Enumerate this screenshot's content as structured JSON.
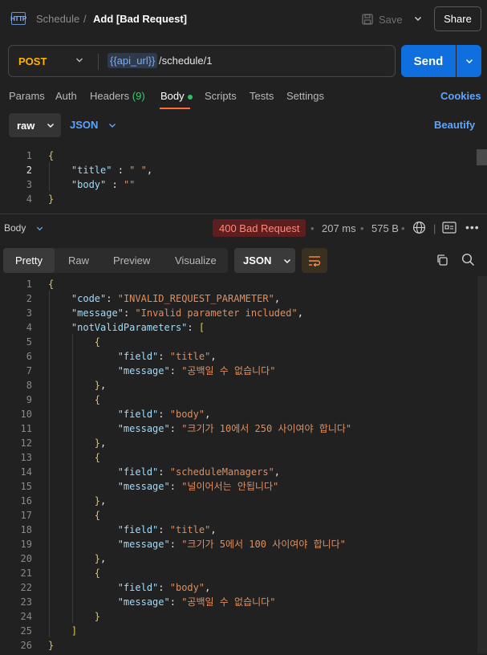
{
  "breadcrumb": {
    "icon_text": "HTTP",
    "parent": "Schedule",
    "separator": "/",
    "current": "Add [Bad Request]"
  },
  "header_actions": {
    "save_label": "Save",
    "share_label": "Share"
  },
  "request": {
    "method": "POST",
    "url_variable": "{{api_url}}",
    "url_path": "/schedule/1",
    "send_label": "Send"
  },
  "request_tabs": [
    {
      "label": "Params"
    },
    {
      "label": "Auth"
    },
    {
      "label": "Headers",
      "count": "(9)"
    },
    {
      "label": "Body"
    },
    {
      "label": "Scripts"
    },
    {
      "label": "Tests"
    },
    {
      "label": "Settings"
    }
  ],
  "cookies_label": "Cookies",
  "body_options": {
    "mode": "raw",
    "language": "JSON",
    "beautify_label": "Beautify"
  },
  "request_body_lines": [
    {
      "n": "1",
      "text": "{"
    },
    {
      "n": "2",
      "text": "    \"title\" : \" \","
    },
    {
      "n": "3",
      "text": "    \"body\" : \"\""
    },
    {
      "n": "4",
      "text": "}"
    }
  ],
  "response": {
    "section_label": "Body",
    "status": "400 Bad Request",
    "time": "207 ms",
    "size": "575 B",
    "bullet": "•",
    "view_tabs": [
      "Pretty",
      "Raw",
      "Preview",
      "Visualize"
    ],
    "format": "JSON"
  },
  "response_body_lines": [
    {
      "n": "1",
      "text": "{"
    },
    {
      "n": "2",
      "text": "    \"code\": \"INVALID_REQUEST_PARAMETER\","
    },
    {
      "n": "3",
      "text": "    \"message\": \"Invalid parameter included\","
    },
    {
      "n": "4",
      "text": "    \"notValidParameters\": ["
    },
    {
      "n": "5",
      "text": "        {"
    },
    {
      "n": "6",
      "text": "            \"field\": \"title\","
    },
    {
      "n": "7",
      "text": "            \"message\": \"공백일 수 없습니다\""
    },
    {
      "n": "8",
      "text": "        },"
    },
    {
      "n": "9",
      "text": "        {"
    },
    {
      "n": "10",
      "text": "            \"field\": \"body\","
    },
    {
      "n": "11",
      "text": "            \"message\": \"크기가 10에서 250 사이여야 합니다\""
    },
    {
      "n": "12",
      "text": "        },"
    },
    {
      "n": "13",
      "text": "        {"
    },
    {
      "n": "14",
      "text": "            \"field\": \"scheduleManagers\","
    },
    {
      "n": "15",
      "text": "            \"message\": \"널이어서는 안됩니다\""
    },
    {
      "n": "16",
      "text": "        },"
    },
    {
      "n": "17",
      "text": "        {"
    },
    {
      "n": "18",
      "text": "            \"field\": \"title\","
    },
    {
      "n": "19",
      "text": "            \"message\": \"크기가 5에서 100 사이여야 합니다\""
    },
    {
      "n": "20",
      "text": "        },"
    },
    {
      "n": "21",
      "text": "        {"
    },
    {
      "n": "22",
      "text": "            \"field\": \"body\","
    },
    {
      "n": "23",
      "text": "            \"message\": \"공백일 수 없습니다\""
    },
    {
      "n": "24",
      "text": "        }"
    },
    {
      "n": "25",
      "text": "    ]"
    },
    {
      "n": "26",
      "text": "}"
    }
  ],
  "colors": {
    "method": "#ffb400",
    "send": "#0f6fde",
    "link": "#5ca5ff",
    "string": "#e08e5f",
    "key": "#9cdcfe",
    "brace": "#e6c34a",
    "status_bg": "#5c1e1e",
    "status_text": "#ff8a7a",
    "tab_underline": "#ff6c37"
  }
}
